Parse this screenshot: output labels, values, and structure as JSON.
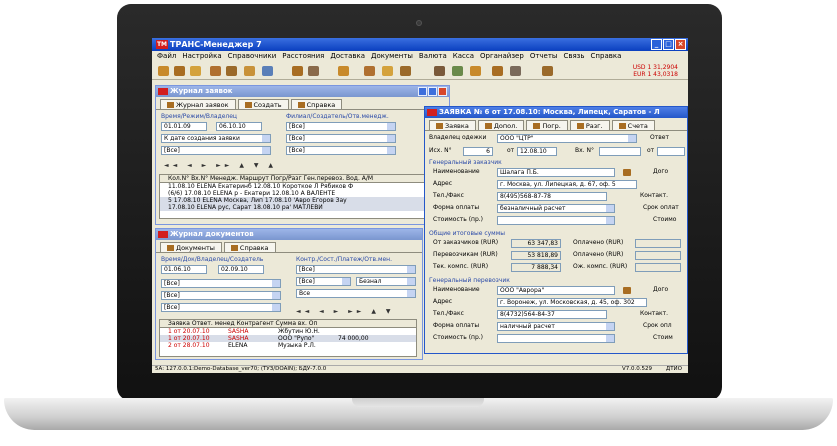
{
  "app": {
    "title": "ТРАНС-Менеджер 7",
    "logo": "ТМ",
    "colors": {
      "titlebar": "#0A3FBF",
      "logo": "#D21E1E",
      "window_bg": "#ECE9D8"
    },
    "menu": [
      "Файл",
      "Настройка",
      "Справочники",
      "Расстояния",
      "Доставка",
      "Документы",
      "Валюта",
      "Касса",
      "Органайзер",
      "Отчеты",
      "Связь",
      "Справка"
    ],
    "toolbar_info": [
      "USD 1 31,2904",
      "EUR 1 43,0318"
    ],
    "status": {
      "left": "5А: 127.0.0.1:Demo-Database_ver70; (ТУЗ/DOAIN); БДУ-7.0.0",
      "right_version": "V7.0.0.529",
      "right_mode": "ДТИО"
    }
  },
  "journal_requests": {
    "title": "Журнал заявок",
    "tabs": [
      "Журнал заявок",
      "Создать",
      "Справка"
    ],
    "section_time": "Время/Режим/Владелец",
    "section_filial": "Филиал/Создатель/Отв.менедж.",
    "date_from": "01.01.09",
    "date_to": "06.10.10",
    "date_mode": "К дате создания заявки",
    "owner": "[Все]",
    "filters": [
      "[Все]",
      "[Все]",
      "[Все]"
    ],
    "grid_header": "Кол.N° Вх.N° Менедж. Маршрут  Погр/Разг  Ген.перевоз.  Вод. А/М",
    "rows": [
      "11.08.10  ELENA   Екатеринб  12.08.10  Короткое Л  Рябиков Ф",
      "(6/6) 17.08.10  ELENA  р - Екатери 12.08.10  А  ВАЛЕНТЕ",
      "5  17.08.10  ELENA  Москва, Лип 17.08.10  'Авро Егоров Зау",
      "  17.08.10  ELENA  рус, Сарат 18.08.10  ра'  МАТЛЕВИ"
    ]
  },
  "journal_docs": {
    "title": "Журнал документов",
    "tabs": [
      "Документы",
      "Справка"
    ],
    "section_time": "Время/Док/Владелец/Создатель",
    "section_contr": "Контр./Сост./Платеж/Отв.мен.",
    "date_from": "01.06.10",
    "date_to": "02.09.10",
    "filters_left": [
      "[Все]",
      "[Все]",
      "[Все]"
    ],
    "filters_right": [
      "[Все]",
      "[Все]",
      "Все"
    ],
    "combo_right": "Безнал",
    "grid_header": "Заявка  Ответ. менед  Контрагент  Сумма вх.  Оп",
    "rows": [
      {
        "req": "1 от 20.07.10",
        "mgr": "SASHA",
        "contr": "Жбутин Ю.Н.",
        "sum": ""
      },
      {
        "req": "1 от 20.07.10",
        "mgr": "SASHA",
        "contr": "ООО \"Рупо\"",
        "sum": "74 000,00"
      },
      {
        "req": "2 от 28.07.10",
        "mgr": "ELENA",
        "contr": "Музыка Р.Л.",
        "sum": ""
      }
    ]
  },
  "order": {
    "title": "ЗАЯВКА № 6 от 17.08.10: Москва, Липецк, Саратов - Л",
    "tabs": [
      "Заявка",
      "Допол.",
      "Погр.",
      "Разг.",
      "Счета"
    ],
    "owner_label": "Владелец одежки",
    "owner_value": "ООО \"ЦТР\"",
    "resp_label": "Ответ",
    "out_label": "Исх. N°",
    "out_no": "6",
    "out_from": "от",
    "out_date": "12.08.10",
    "in_label": "Вх. N°",
    "in_from": "от",
    "customer_section": "Генеральный заказчик",
    "name_label": "Наименование",
    "customer_name": "Шалага П.Б.",
    "doc_label": "Дого",
    "address_label": "Адрес",
    "customer_address": "г. Москва, ул. Липецкая, д. 67, оф. 5",
    "phone_label": "Тел./Факс",
    "customer_phone": "8(495)568-87-78",
    "contact_label": "Контакт.",
    "payform_label": "Форма оплаты",
    "customer_payform": "безналичный расчет",
    "paydue_label": "Срок оплат",
    "cost_label": "Стоимость (пр.)",
    "cost_label2": "Стоимо",
    "totals_section": "Общие итоговые суммы",
    "totals": [
      {
        "label": "От заказчиков (RUR)",
        "value": "63 347,83",
        "r_label": "Оплачено (RUR)"
      },
      {
        "label": "Перевозчикам (RUR)",
        "value": "53 818,89",
        "r_label": "Оплачено (RUR)"
      },
      {
        "label": "Тек. компс. (RUR)",
        "value": "7 888,34",
        "r_label": "Ож. компс. (RUR)"
      }
    ],
    "carrier_section": "Генеральный перевозчик",
    "carrier_name": "ООО \"Аврора\"",
    "carrier_address": "г. Воронеж, ул. Московская, д. 45, оф. 302",
    "carrier_phone": "8(4732)564-84-37",
    "carrier_payform": "наличный расчет",
    "carrier_doc_label": "Дого",
    "carrier_contact_label": "Контакт.",
    "carrier_paydue_label": "Срок опл",
    "carrier_cost_label": "Стоимость (пр.)",
    "carrier_cost_label2": "Стоим"
  }
}
